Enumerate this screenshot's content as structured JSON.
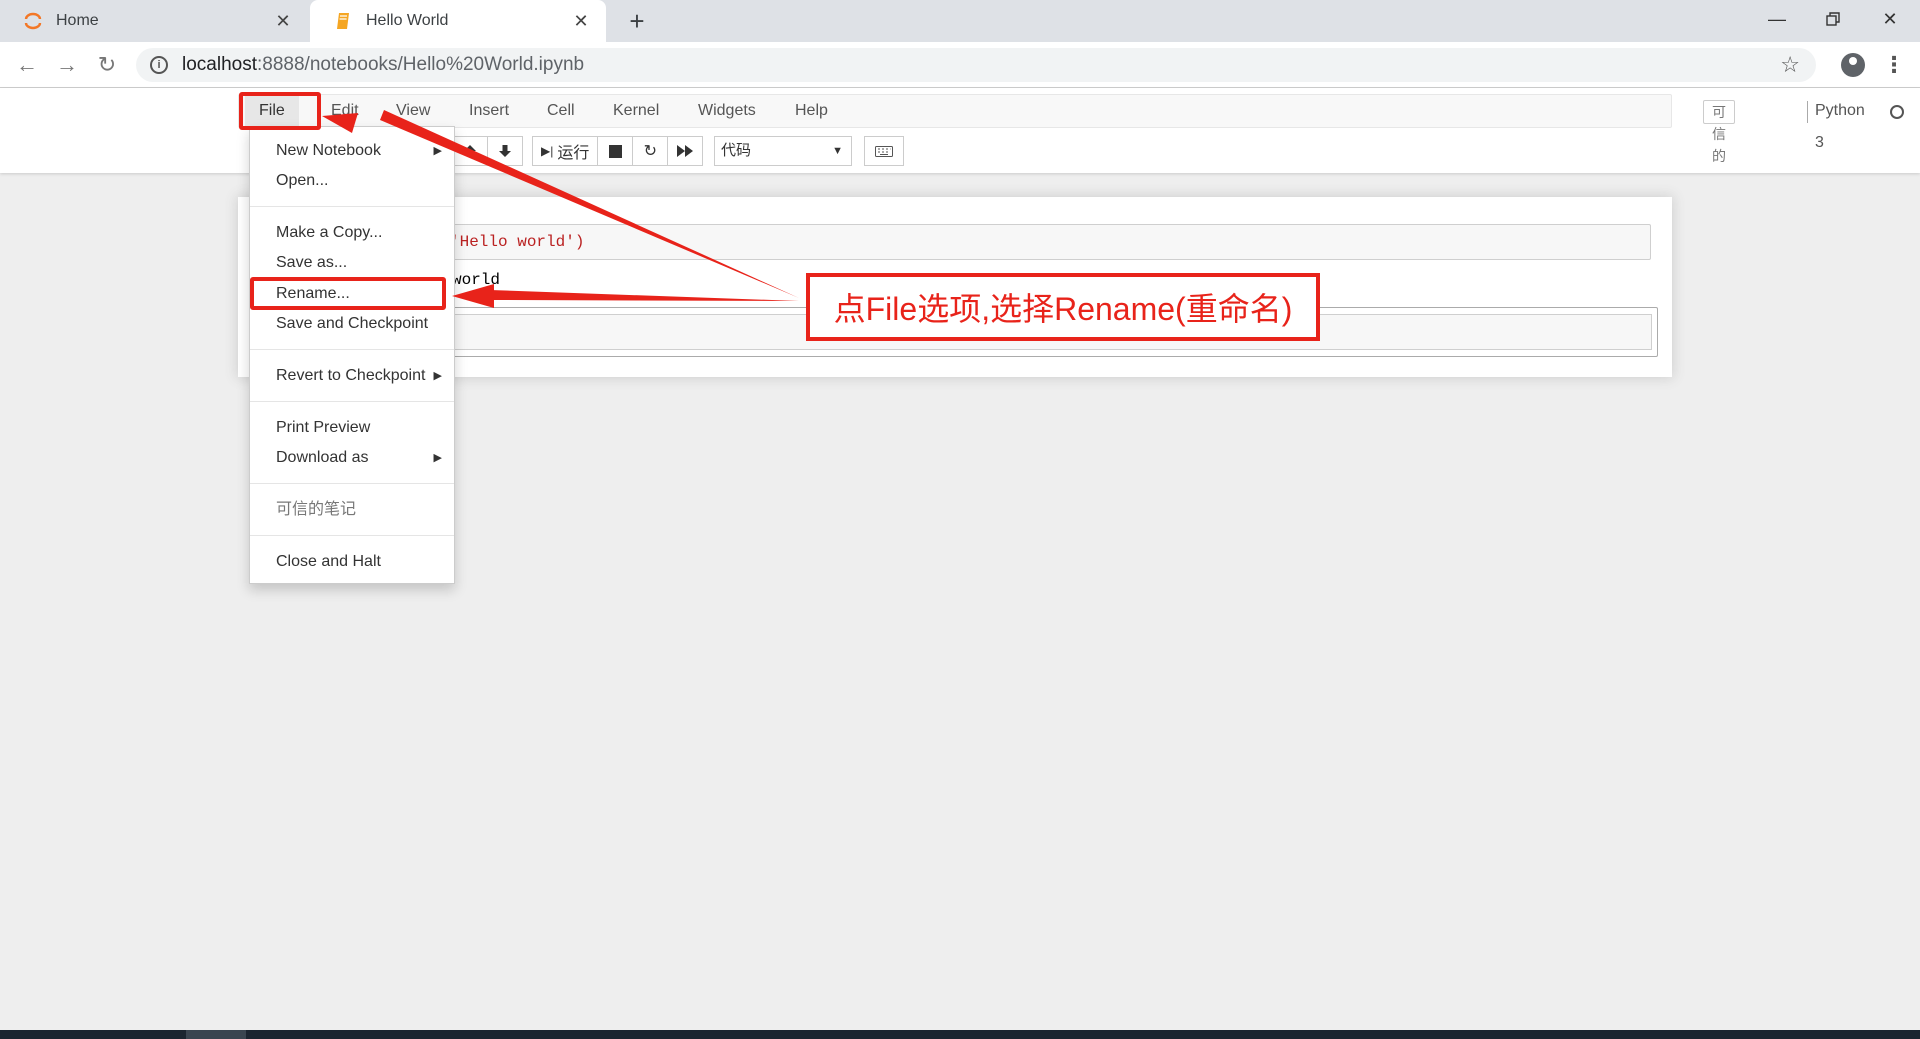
{
  "browser": {
    "tabs": [
      {
        "title": "Home",
        "icon": "jupyter-logo-icon",
        "active": false
      },
      {
        "title": "Hello World",
        "icon": "notebook-icon",
        "active": true
      }
    ],
    "new_tab_label": "+",
    "url_host": "localhost",
    "url_path": ":8888/notebooks/Hello%20World.ipynb"
  },
  "jupyter": {
    "menu": [
      "File",
      "Edit",
      "View",
      "Insert",
      "Cell",
      "Kernel",
      "Widgets",
      "Help"
    ],
    "trusted_label": "可信的",
    "kernel_name": "Python 3",
    "toolbar": {
      "run_label": "运行",
      "cell_type": "代码"
    },
    "cells": [
      {
        "input_text": "'Hello world')",
        "output_text": "world"
      }
    ]
  },
  "file_menu": {
    "items": [
      {
        "label": "New Notebook",
        "submenu": true
      },
      {
        "label": "Open..."
      },
      {
        "label": "Make a Copy..."
      },
      {
        "label": "Save as..."
      },
      {
        "label": "Rename..."
      },
      {
        "label": "Save and Checkpoint"
      },
      {
        "label": "Revert to Checkpoint",
        "submenu": true
      },
      {
        "label": "Print Preview"
      },
      {
        "label": "Download as",
        "submenu": true
      },
      {
        "label": "可信的笔记",
        "disabled": true
      },
      {
        "label": "Close and Halt"
      }
    ]
  },
  "annotation": {
    "callout_text": "点File选项,选择Rename(重命名)",
    "color": "#e8231a"
  },
  "colors": {
    "accent": "#e8231a",
    "jupyter_orange": "#f37726",
    "tab_strip": "#dee1e6",
    "page_bg": "#eeeeee"
  }
}
